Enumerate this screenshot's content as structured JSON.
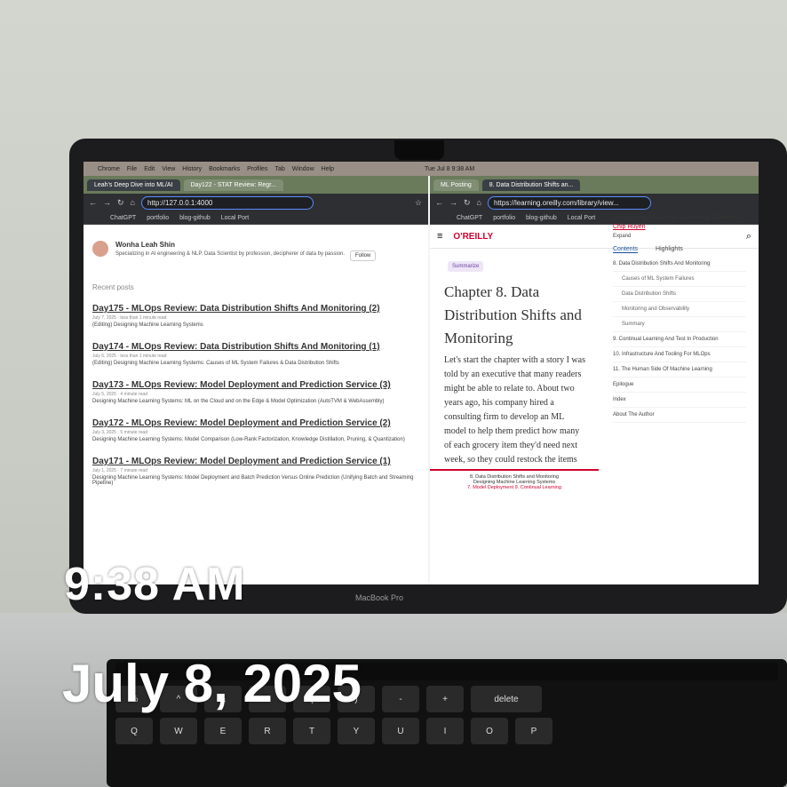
{
  "menu": {
    "apple": "",
    "items": [
      "Chrome",
      "File",
      "Edit",
      "View",
      "History",
      "Bookmarks",
      "Profiles",
      "Tab",
      "Window",
      "Help"
    ],
    "clock": "Tue Jul 8  9:38 AM"
  },
  "left": {
    "tabs": [
      "Leah's Deep Dive into ML/AI",
      "Day122 - STAT Review: Regr..."
    ],
    "url": "http://127.0.0.1:4000",
    "bookmarks": [
      "ChatGPT",
      "portfolio",
      "blog-github",
      "Local Port"
    ],
    "author": {
      "name": "Wonha Leah Shin",
      "bio": "Specializing in AI engineering & NLP. Data Scientist by profession, decipherer of data by passion.",
      "follow": "Follow"
    },
    "recent_label": "Recent posts",
    "posts": [
      {
        "title": "Day175 - MLOps Review: Data Distribution Shifts And Monitoring (2)",
        "meta": "July 7, 2025  ·  less than 1 minute read",
        "desc": "(Editing) Designing Machine Learning Systems"
      },
      {
        "title": "Day174 - MLOps Review: Data Distribution Shifts And Monitoring (1)",
        "meta": "July 6, 2025  ·  less than 1 minute read",
        "desc": "(Editing) Designing Machine Learning Systems: Causes of ML System Failures & Data Distribution Shifts"
      },
      {
        "title": "Day173 - MLOps Review: Model Deployment and Prediction Service (3)",
        "meta": "July 5, 2025  ·  4 minute read",
        "desc": "Designing Machine Learning Systems: ML on the Cloud and on the Edge & Model Optimization (AutoTVM & WebAssembly)"
      },
      {
        "title": "Day172 - MLOps Review: Model Deployment and Prediction Service (2)",
        "meta": "July 3, 2025  ·  5 minute read",
        "desc": "Designing Machine Learning Systems: Model Comparison (Low-Rank Factorization, Knowledge Distillation, Pruning, & Quantization)"
      },
      {
        "title": "Day171 - MLOps Review: Model Deployment and Prediction Service (1)",
        "meta": "July 1, 2025  ·  7 minute read",
        "desc": "Designing Machine Learning Systems: Model Deployment and Batch Prediction Versus Online Prediction (Unifying Batch and Streaming Pipeline)"
      }
    ]
  },
  "right": {
    "tabs": [
      "ML Posting",
      "8. Data Distribution Shifts an..."
    ],
    "url": "https://learning.oreilly.com/library/view...",
    "logo": "O'REILLY",
    "summarize": "Summarize",
    "chapter": "Chapter 8. Data Distribution Shifts and Monitoring",
    "body": "Let's start the chapter with a story I was told by an executive that many readers might be able to relate to. About two years ago, his company hired a consulting firm to develop an ML model to help them predict how many of each grocery item they'd need next week, so they could restock the items accordingly. The consulting",
    "footer": {
      "title": "8. Data Distribution Shifts and Monitoring",
      "book": "Designing Machine Learning Systems",
      "prev": "7. Model Deployment",
      "next": "9. Continual Learning"
    },
    "book": {
      "title": "Designing Machine Learning Systems",
      "author": "Chip Huyen",
      "expand": "Expand",
      "tab_contents": "Contents",
      "tab_highlights": "Highlights"
    },
    "toc": [
      {
        "label": "8. Data Distribution Shifts And Monitoring",
        "sub": false
      },
      {
        "label": "Causes of ML System Failures",
        "sub": true
      },
      {
        "label": "Data Distribution Shifts",
        "sub": true
      },
      {
        "label": "Monitoring and Observability",
        "sub": true
      },
      {
        "label": "Summary",
        "sub": true
      },
      {
        "label": "9. Continual Learning And Test In Production",
        "sub": false
      },
      {
        "label": "10. Infrastructure And Tooling For MLOps",
        "sub": false
      },
      {
        "label": "11. The Human Side Of Machine Learning",
        "sub": false
      },
      {
        "label": "Epilogue",
        "sub": false
      },
      {
        "label": "Index",
        "sub": false
      },
      {
        "label": "About The Author",
        "sub": false
      }
    ]
  },
  "overlay": {
    "time": "9:38 AM",
    "date": "July 8, 2025"
  },
  "device": {
    "label": "MacBook Pro"
  },
  "keyboard": {
    "row1": [
      "Q",
      "W",
      "E",
      "R",
      "T",
      "Y",
      "U",
      "I",
      "O",
      "P"
    ],
    "row0": [
      "%",
      "^",
      "&",
      "*",
      "(",
      ")",
      "-",
      "+",
      "delete"
    ]
  }
}
